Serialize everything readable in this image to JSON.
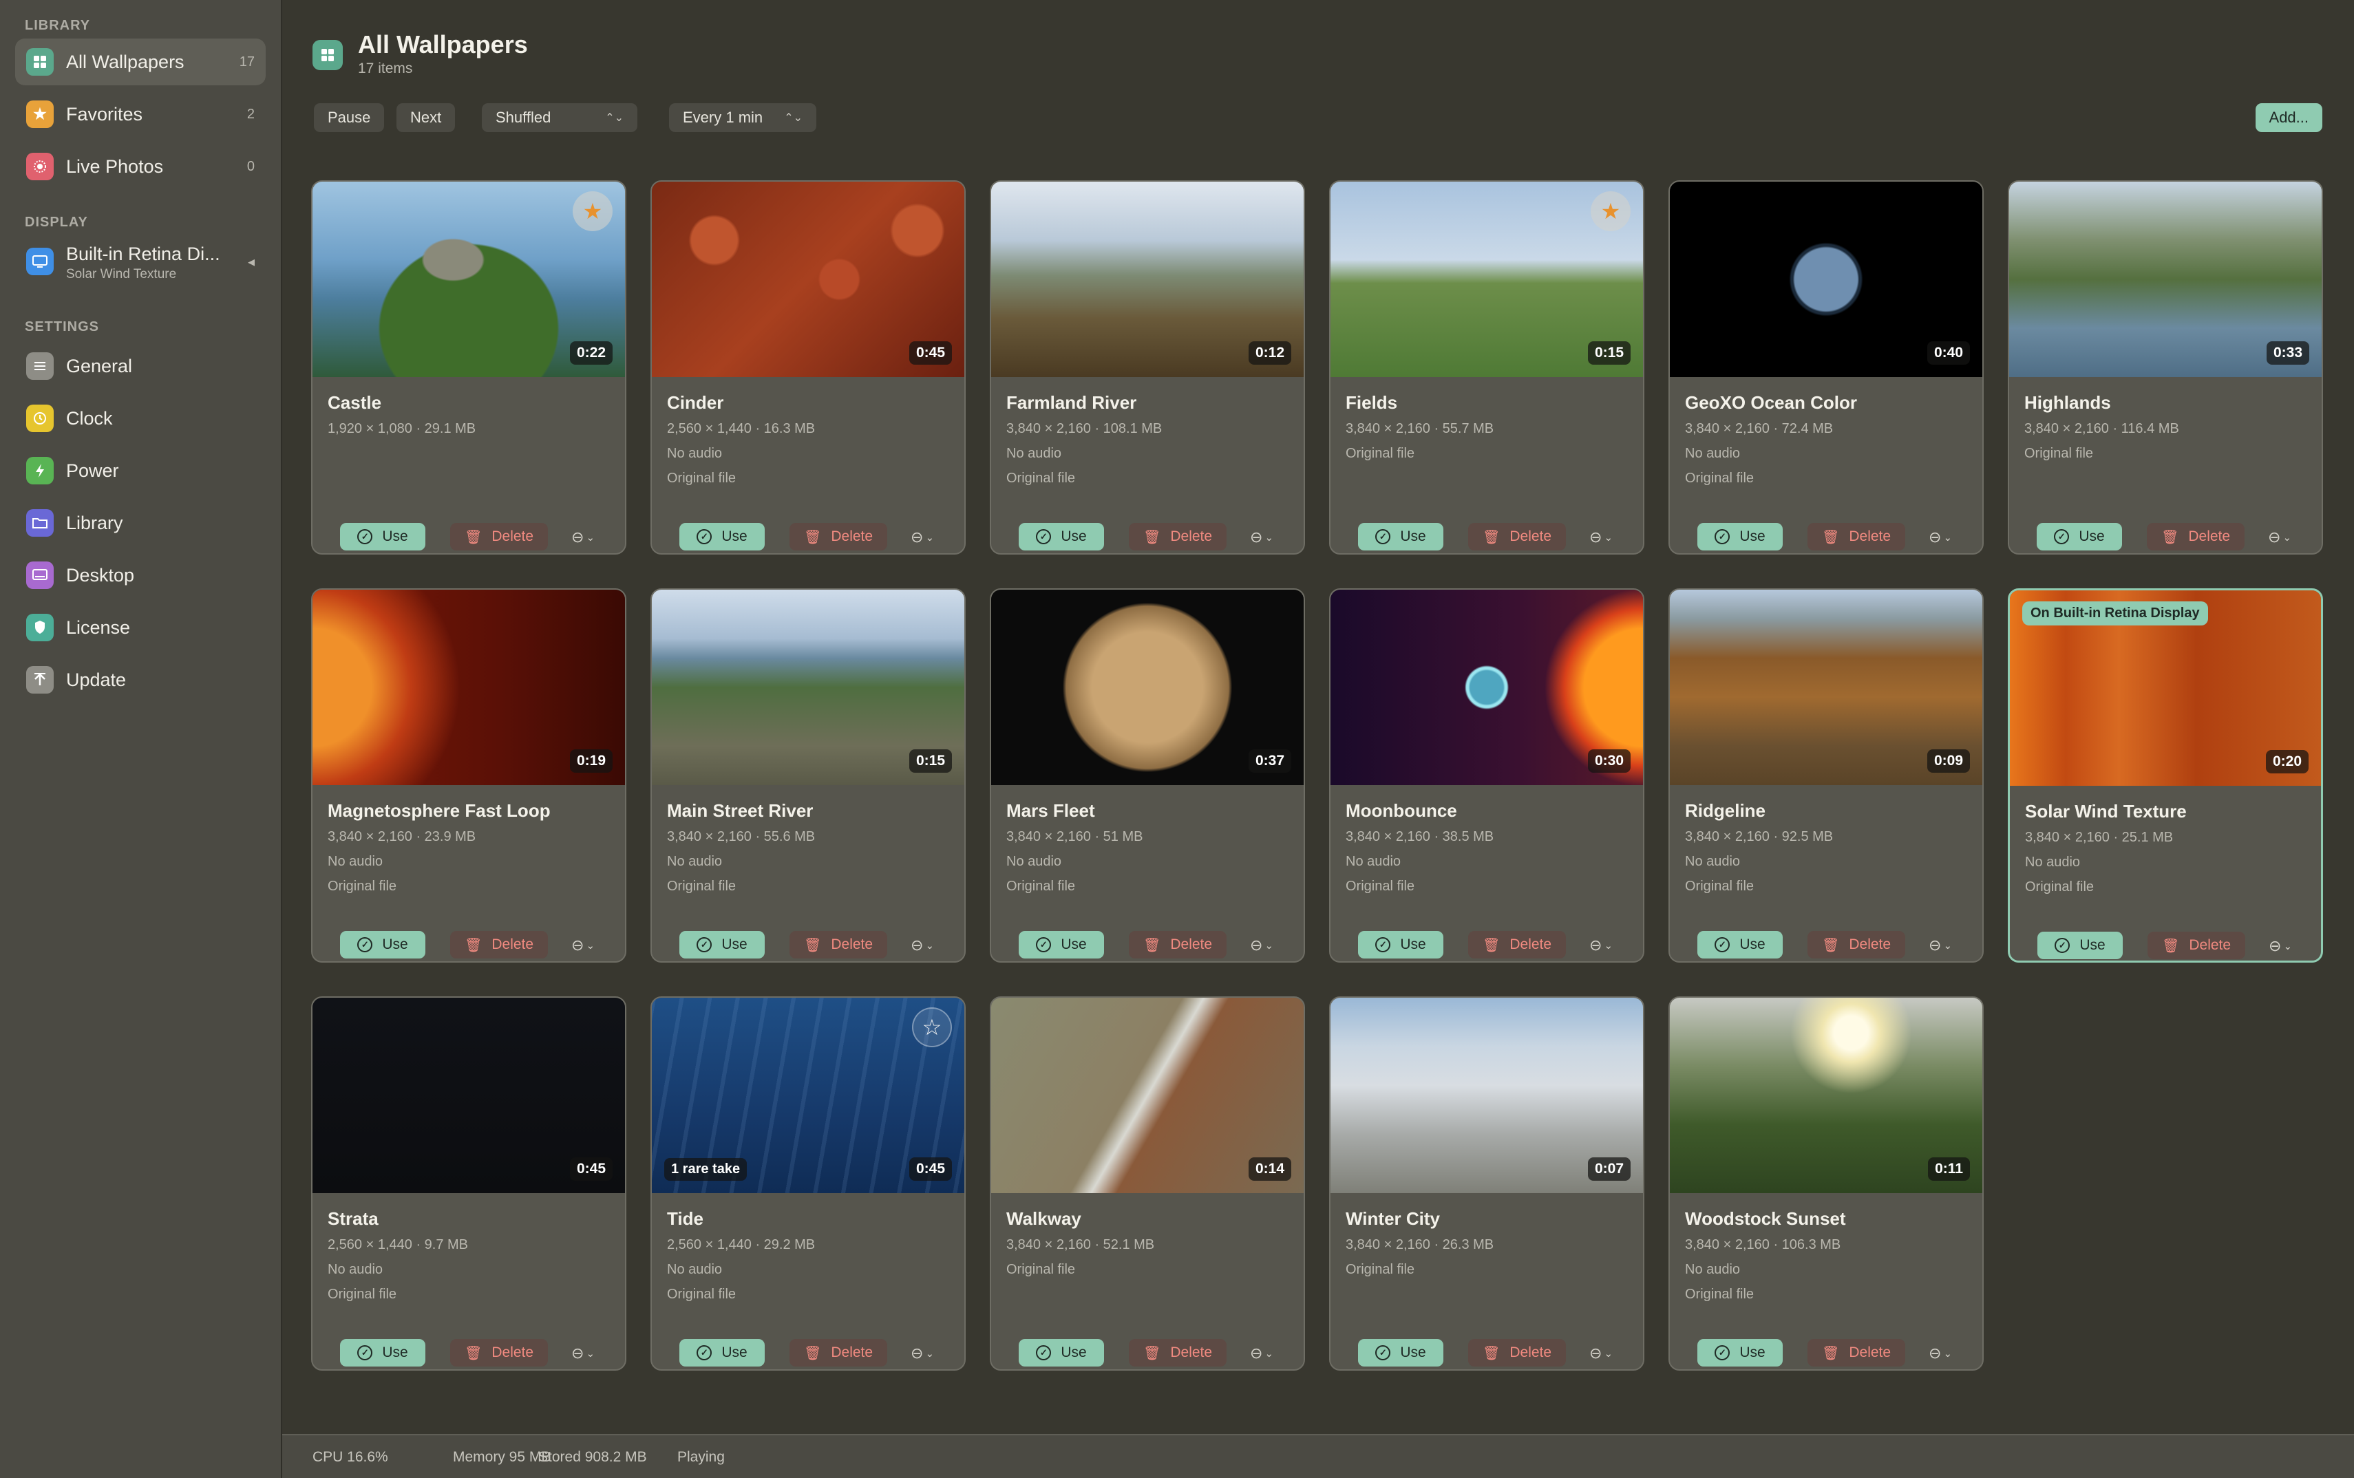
{
  "sidebar": {
    "library_header": "LIBRARY",
    "library_items": [
      {
        "label": "All Wallpapers",
        "count": "17",
        "icon": "grid-icon",
        "color": "#5ba88c"
      },
      {
        "label": "Favorites",
        "count": "2",
        "icon": "star-icon",
        "color": "#e8a23a"
      },
      {
        "label": "Live Photos",
        "count": "0",
        "icon": "live-photo-icon",
        "color": "#e0616e"
      }
    ],
    "display_header": "DISPLAY",
    "display_item": {
      "label": "Built-in Retina Di...",
      "sublabel": "Solar Wind Texture",
      "icon": "display-icon",
      "color": "#3f8fe6"
    },
    "settings_header": "SETTINGS",
    "settings_items": [
      {
        "label": "General",
        "icon": "sliders-icon",
        "color": "#8e8d86"
      },
      {
        "label": "Clock",
        "icon": "clock-icon",
        "color": "#e6c52e"
      },
      {
        "label": "Power",
        "icon": "bolt-icon",
        "color": "#59b454"
      },
      {
        "label": "Library",
        "icon": "folder-icon",
        "color": "#6a68d6"
      },
      {
        "label": "Desktop",
        "icon": "desktop-icon",
        "color": "#a86ad0"
      },
      {
        "label": "License",
        "icon": "shield-icon",
        "color": "#4cae98"
      },
      {
        "label": "Update",
        "icon": "arrow-up-icon",
        "color": "#8e8d86"
      }
    ]
  },
  "header": {
    "title": "All Wallpapers",
    "subtitle": "17 items"
  },
  "toolbar": {
    "pause": "Pause",
    "next": "Next",
    "order": "Shuffled",
    "interval": "Every 1 min",
    "add": "Add..."
  },
  "card_labels": {
    "use": "Use",
    "delete": "Delete"
  },
  "wallpapers": [
    {
      "name": "Castle",
      "dims": "1,920 × 1,080 · 29.1 MB",
      "audio": "",
      "file": "",
      "duration": "0:22",
      "favorite": true
    },
    {
      "name": "Cinder",
      "dims": "2,560 × 1,440 · 16.3 MB",
      "audio": "No audio",
      "file": "Original file",
      "duration": "0:45"
    },
    {
      "name": "Farmland River",
      "dims": "3,840 × 2,160 · 108.1 MB",
      "audio": "No audio",
      "file": "Original file",
      "duration": "0:12"
    },
    {
      "name": "Fields",
      "dims": "3,840 × 2,160 · 55.7 MB",
      "audio": "Original file",
      "file": "",
      "duration": "0:15",
      "favorite": true
    },
    {
      "name": "GeoXO Ocean Color",
      "dims": "3,840 × 2,160 · 72.4 MB",
      "audio": "No audio",
      "file": "Original file",
      "duration": "0:40"
    },
    {
      "name": "Highlands",
      "dims": "3,840 × 2,160 · 116.4 MB",
      "audio": "Original file",
      "file": "",
      "duration": "0:33"
    },
    {
      "name": "Magnetosphere Fast Loop",
      "dims": "3,840 × 2,160 · 23.9 MB",
      "audio": "No audio",
      "file": "Original file",
      "duration": "0:19"
    },
    {
      "name": "Main Street River",
      "dims": "3,840 × 2,160 · 55.6 MB",
      "audio": "No audio",
      "file": "Original file",
      "duration": "0:15"
    },
    {
      "name": "Mars Fleet",
      "dims": "3,840 × 2,160 · 51 MB",
      "audio": "No audio",
      "file": "Original file",
      "duration": "0:37"
    },
    {
      "name": "Moonbounce",
      "dims": "3,840 × 2,160 · 38.5 MB",
      "audio": "No audio",
      "file": "Original file",
      "duration": "0:30"
    },
    {
      "name": "Ridgeline",
      "dims": "3,840 × 2,160 · 92.5 MB",
      "audio": "No audio",
      "file": "Original file",
      "duration": "0:09"
    },
    {
      "name": "Solar Wind Texture",
      "dims": "3,840 × 2,160 · 25.1 MB",
      "audio": "No audio",
      "file": "Original file",
      "duration": "0:20",
      "active_badge": "On Built-in Retina Display"
    },
    {
      "name": "Strata",
      "dims": "2,560 × 1,440 · 9.7 MB",
      "audio": "No audio",
      "file": "Original file",
      "duration": "0:45"
    },
    {
      "name": "Tide",
      "dims": "2,560 × 1,440 · 29.2 MB",
      "audio": "No audio",
      "file": "Original file",
      "duration": "0:45",
      "tag": "1 rare take",
      "favorite": false
    },
    {
      "name": "Walkway",
      "dims": "3,840 × 2,160 · 52.1 MB",
      "audio": "Original file",
      "file": "",
      "duration": "0:14"
    },
    {
      "name": "Winter City",
      "dims": "3,840 × 2,160 · 26.3 MB",
      "audio": "Original file",
      "file": "",
      "duration": "0:07"
    },
    {
      "name": "Woodstock Sunset",
      "dims": "3,840 × 2,160 · 106.3 MB",
      "audio": "No audio",
      "file": "Original file",
      "duration": "0:11"
    }
  ],
  "status": {
    "cpu": "CPU 16.6%",
    "memory": "Memory 95 MB",
    "stored": "Stored 908.2 MB",
    "state": "Playing"
  },
  "colors": {
    "accent": "#8fcbb1",
    "danger": "#f08a80",
    "favorite": "#e8922e"
  }
}
